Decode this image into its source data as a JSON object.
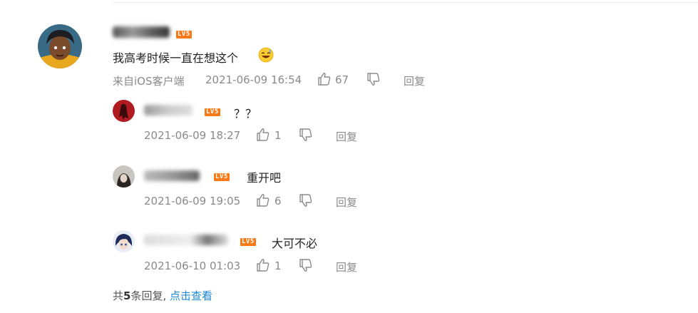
{
  "main_comment": {
    "level_badge": "LV5",
    "text": "我高考时候一直在想这个",
    "emoji": "grinning-sweat-emoji",
    "source": "来自iOS客户端",
    "time": "2021-06-09 16:54",
    "likes": "67",
    "reply_label": "回复"
  },
  "replies": [
    {
      "level_badge": "LV5",
      "text": "？？",
      "time": "2021-06-09 18:27",
      "likes": "1",
      "reply_label": "回复"
    },
    {
      "level_badge": "LV5",
      "text": "重开吧",
      "time": "2021-06-09 19:05",
      "likes": "6",
      "reply_label": "回复"
    },
    {
      "level_badge": "LV5",
      "text": "大可不必",
      "time": "2021-06-10 01:03",
      "likes": "1",
      "reply_label": "回复"
    }
  ],
  "summary": {
    "prefix": "共",
    "count": "5",
    "suffix": "条回复,",
    "link": "点击查看"
  },
  "colors": {
    "level_badge": "#f77a16",
    "link": "#1d87d6",
    "meta_text": "#8a8a8a"
  }
}
